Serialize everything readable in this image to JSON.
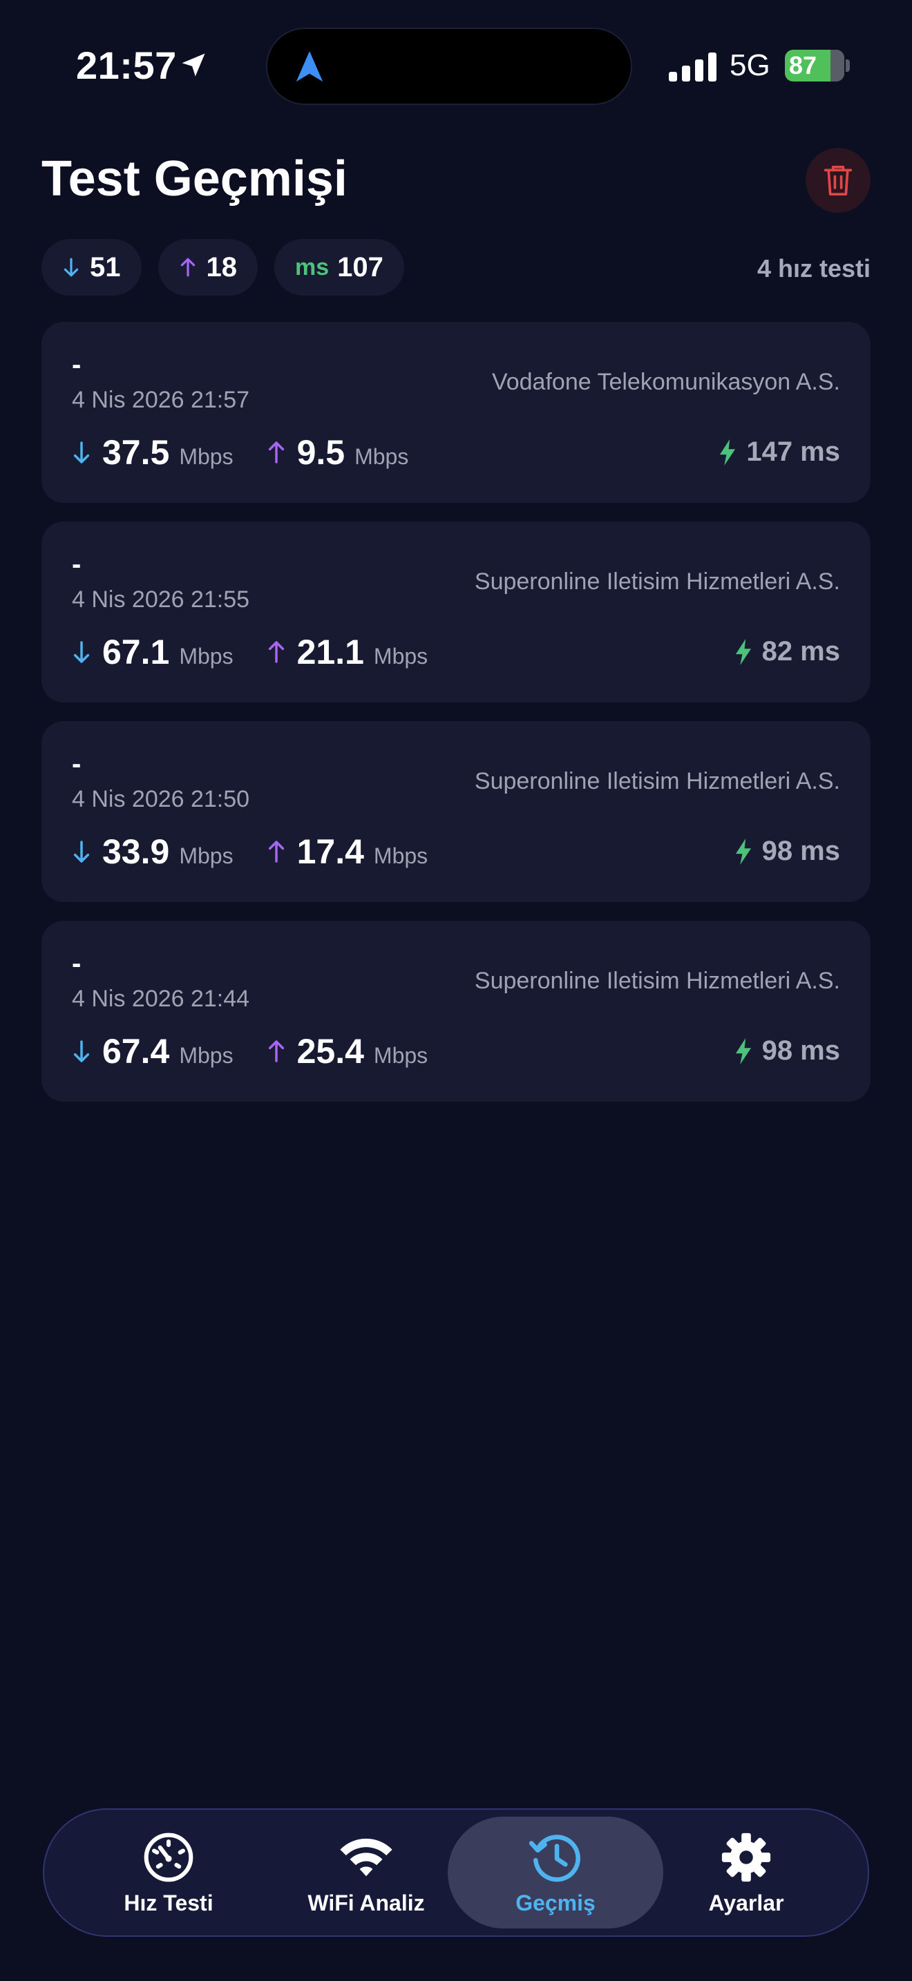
{
  "status_bar": {
    "time": "21:57",
    "network": "5G",
    "battery": "87"
  },
  "header": {
    "title": "Test Geçmişi"
  },
  "summary": {
    "download": "51",
    "upload": "18",
    "ping_label": "ms",
    "ping": "107",
    "test_count": "4 hız testi"
  },
  "unit": "Mbps",
  "tests": [
    {
      "name": "-",
      "date": "4 Nis 2026 21:57",
      "isp": "Vodafone Telekomunikasyon A.S.",
      "download": "37.5",
      "upload": "9.5",
      "ping": "147 ms"
    },
    {
      "name": "-",
      "date": "4 Nis 2026 21:55",
      "isp": "Superonline Iletisim Hizmetleri A.S.",
      "download": "67.1",
      "upload": "21.1",
      "ping": "82 ms"
    },
    {
      "name": "-",
      "date": "4 Nis 2026 21:50",
      "isp": "Superonline Iletisim Hizmetleri A.S.",
      "download": "33.9",
      "upload": "17.4",
      "ping": "98 ms"
    },
    {
      "name": "-",
      "date": "4 Nis 2026 21:44",
      "isp": "Superonline Iletisim Hizmetleri A.S.",
      "download": "67.4",
      "upload": "25.4",
      "ping": "98 ms"
    }
  ],
  "tabs": [
    {
      "label": "Hız Testi",
      "icon": "speedometer-icon"
    },
    {
      "label": "WiFi Analiz",
      "icon": "wifi-icon"
    },
    {
      "label": "Geçmiş",
      "icon": "history-icon",
      "active": true
    },
    {
      "label": "Ayarlar",
      "icon": "gear-icon"
    }
  ],
  "colors": {
    "background": "#0c0e22",
    "card": "#171a30",
    "download": "#4fb3f0",
    "upload": "#a566f5",
    "ping": "#4cc27a",
    "danger": "#e04848"
  }
}
